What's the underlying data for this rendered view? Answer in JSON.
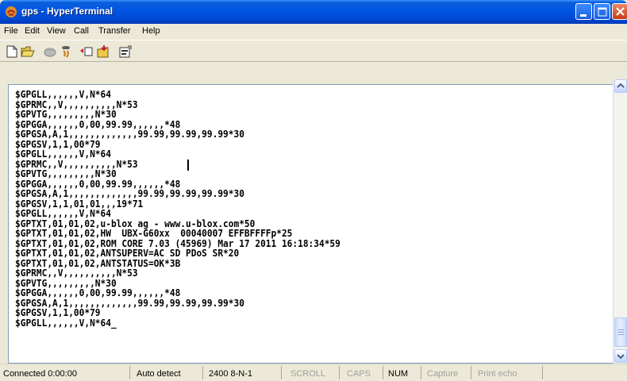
{
  "window": {
    "title": "gps - HyperTerminal",
    "app_icon": "hyperterminal-phone-icon",
    "buttons": [
      "minimize-icon",
      "maximize-icon",
      "close-icon"
    ]
  },
  "menu": [
    {
      "label": "File",
      "name": "menu-file"
    },
    {
      "label": "Edit",
      "name": "menu-edit"
    },
    {
      "label": "View",
      "name": "menu-view"
    },
    {
      "label": "Call",
      "name": "menu-call"
    },
    {
      "label": "Transfer",
      "name": "menu-transfer"
    },
    {
      "label": "Help",
      "name": "menu-help"
    }
  ],
  "toolbar": {
    "icons": [
      "new-connection-icon",
      "open-folder-icon",
      "dial-icon",
      "disconnect-icon",
      "send-icon",
      "receive-icon",
      "properties-icon"
    ]
  },
  "terminal": {
    "lines": [
      "$GPGLL,,,,,,V,N*64",
      "$GPRMC,,V,,,,,,,,,,N*53",
      "$GPVTG,,,,,,,,,N*30",
      "$GPGGA,,,,,,0,00,99.99,,,,,,*48",
      "$GPGSA,A,1,,,,,,,,,,,,,99.99,99.99,99.99*30",
      "$GPGSV,1,1,00*79",
      "$GPGLL,,,,,,V,N*64",
      "$GPRMC,,V,,,,,,,,,,N*53",
      "$GPVTG,,,,,,,,,N*30",
      "$GPGGA,,,,,,0,00,99.99,,,,,,*48",
      "$GPGSA,A,1,,,,,,,,,,,,,99.99,99.99,99.99*30",
      "$GPGSV,1,1,01,01,,,19*71",
      "$GPGLL,,,,,,V,N*64",
      "$GPTXT,01,01,02,u-blox ag - www.u-blox.com*50",
      "$GPTXT,01,01,02,HW  UBX-G60xx  00040007 EFFBFFFFp*25",
      "$GPTXT,01,01,02,ROM CORE 7.03 (45969) Mar 17 2011 16:18:34*59",
      "$GPTXT,01,01,02,ANTSUPERV=AC SD PDoS SR*20",
      "$GPTXT,01,01,02,ANTSTATUS=OK*3B",
      "$GPRMC,,V,,,,,,,,,,N*53",
      "$GPVTG,,,,,,,,,N*30",
      "$GPGGA,,,,,,0,00,99.99,,,,,,*48",
      "$GPGSA,A,1,,,,,,,,,,,,,99.99,99.99,99.99*30",
      "$GPGSV,1,1,00*79",
      "$GPGLL,,,,,,V,N*64_"
    ]
  },
  "status": {
    "connected": "Connected 0:00:00",
    "detect": "Auto detect",
    "settings": "2400 8-N-1",
    "scroll": "SCROLL",
    "caps": "CAPS",
    "num": "NUM",
    "capture": "Capture",
    "print_echo": "Print echo"
  }
}
